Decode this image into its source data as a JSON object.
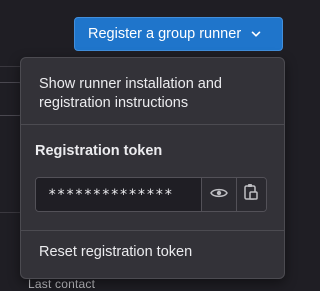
{
  "background": {
    "partial_text": "Last contact"
  },
  "header": {
    "register_button_label": "Register a group runner"
  },
  "dropdown": {
    "show_instructions_label": "Show runner installation and registration instructions",
    "token_heading": "Registration token",
    "token_masked": "**************",
    "reveal_icon": "eye-icon",
    "copy_icon": "clipboard-icon",
    "reset_label": "Reset registration token"
  },
  "colors": {
    "page_bg": "#1f1e24",
    "button_bg": "#1f75cb",
    "dropdown_bg": "#333238",
    "text": "#ececef"
  }
}
